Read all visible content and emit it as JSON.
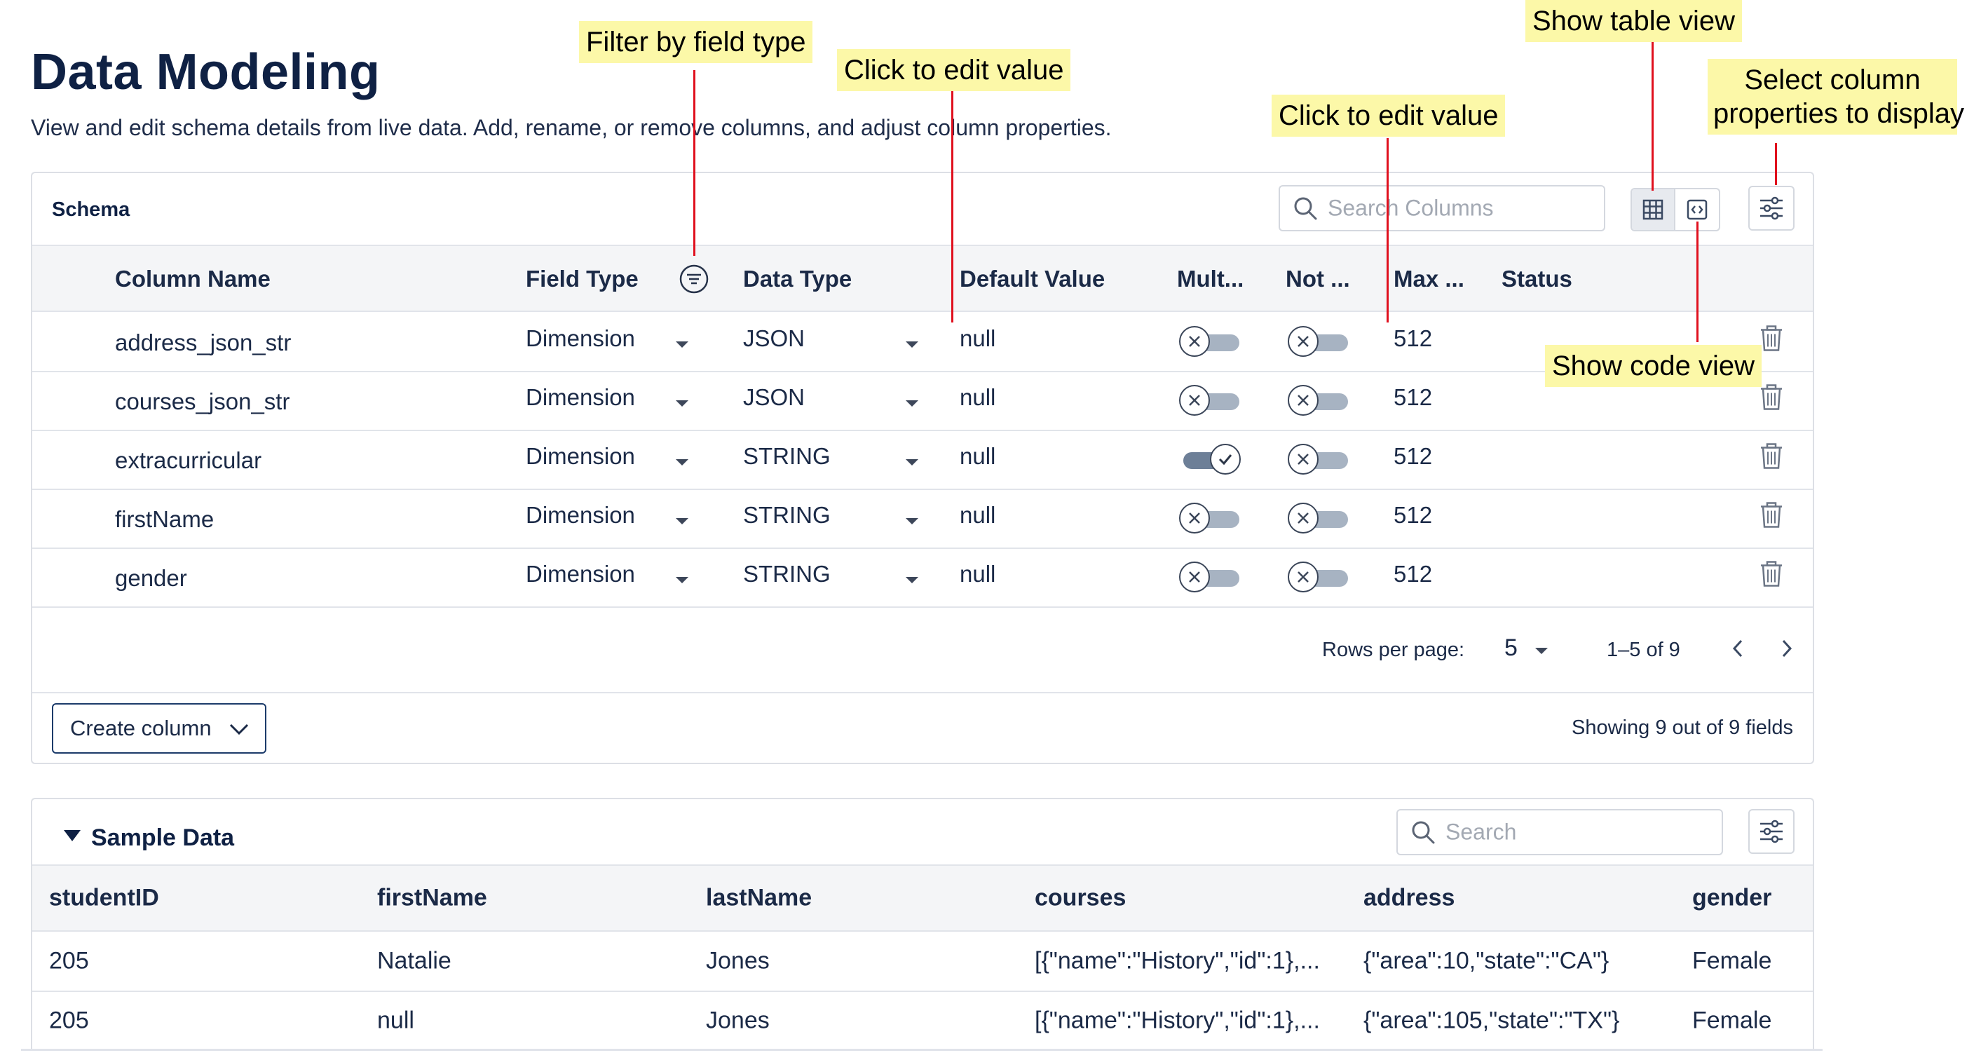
{
  "page": {
    "title": "Data Modeling",
    "subtitle": "View and edit schema details from live data. Add, rename, or remove columns, and adjust column properties."
  },
  "schema": {
    "title": "Schema",
    "search_placeholder": "Search Columns",
    "columns": {
      "column_name": "Column Name",
      "field_type": "Field Type",
      "data_type": "Data Type",
      "default_value": "Default Value",
      "multi": "Mult...",
      "not_null": "Not ...",
      "max": "Max ...",
      "status": "Status"
    },
    "rows": [
      {
        "name": "address_json_str",
        "field_type": "Dimension",
        "data_type": "JSON",
        "default": "null",
        "multi": false,
        "not_null": false,
        "max": "512"
      },
      {
        "name": "courses_json_str",
        "field_type": "Dimension",
        "data_type": "JSON",
        "default": "null",
        "multi": false,
        "not_null": false,
        "max": "512"
      },
      {
        "name": "extracurricular",
        "field_type": "Dimension",
        "data_type": "STRING",
        "default": "null",
        "multi": true,
        "not_null": false,
        "max": "512"
      },
      {
        "name": "firstName",
        "field_type": "Dimension",
        "data_type": "STRING",
        "default": "null",
        "multi": false,
        "not_null": false,
        "max": "512"
      },
      {
        "name": "gender",
        "field_type": "Dimension",
        "data_type": "STRING",
        "default": "null",
        "multi": false,
        "not_null": false,
        "max": "512"
      }
    ],
    "pagination": {
      "rows_per_page_label": "Rows per page:",
      "rows_per_page": "5",
      "range": "1–5 of 9"
    },
    "create_column_label": "Create column",
    "showing_text": "Showing 9 out of 9 fields"
  },
  "sample": {
    "title": "Sample Data",
    "search_placeholder": "Search",
    "columns": [
      "studentID",
      "firstName",
      "lastName",
      "courses",
      "address",
      "gender"
    ],
    "rows": [
      [
        "205",
        "Natalie",
        "Jones",
        "[{\"name\":\"History\",\"id\":1},...",
        "{\"area\":10,\"state\":\"CA\"}",
        "Female"
      ],
      [
        "205",
        "null",
        "Jones",
        "[{\"name\":\"History\",\"id\":1},...",
        "{\"area\":105,\"state\":\"TX\"}",
        "Female"
      ]
    ]
  },
  "annotations": {
    "filter_by_field_type": "Filter by field type",
    "click_to_edit_1": "Click to edit value",
    "click_to_edit_2": "Click to edit value",
    "show_table_view": "Show table view",
    "select_column_properties_1": "Select column",
    "select_column_properties_2": "properties to display",
    "show_code_view": "Show code view"
  },
  "colors": {
    "annotation_bg": "#fcf8a8",
    "annotation_line": "#e0101e",
    "header_bg": "#f4f5f7",
    "title": "#0f2144"
  },
  "icons": [
    "search-icon",
    "table-view-icon",
    "code-view-icon",
    "settings-sliders-icon",
    "filter-icon",
    "caret-down-icon",
    "toggle-x-icon",
    "toggle-check-icon",
    "trash-icon",
    "chevron-left-icon",
    "chevron-right-icon",
    "chevron-down-icon",
    "triangle-down-icon"
  ]
}
